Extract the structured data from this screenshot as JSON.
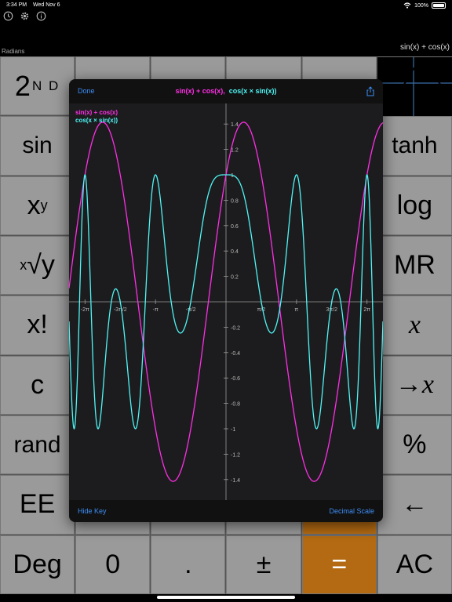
{
  "status_bar": {
    "time": "3:34 PM",
    "date": "Wed Nov 6",
    "battery": "100%"
  },
  "toolbar": {
    "icons": [
      "history-icon",
      "gear-icon",
      "info-icon"
    ],
    "mode": "Radians",
    "expression": "sin(x) + cos(x)"
  },
  "keypad": {
    "rows": [
      [
        "2ND",
        "",
        "",
        "",
        "",
        ""
      ],
      [
        "sin",
        "",
        "",
        "",
        "",
        "tanh"
      ],
      [
        "x^y",
        "",
        "",
        "",
        "",
        "log"
      ],
      [
        "x√y",
        "",
        "",
        "",
        "",
        "MR"
      ],
      [
        "x!",
        "",
        "",
        "",
        "",
        "x"
      ],
      [
        "c",
        "",
        "",
        "",
        "",
        "→x"
      ],
      [
        "rand",
        "",
        "",
        "",
        "",
        "%"
      ],
      [
        "EE",
        "",
        "",
        "",
        "",
        "←"
      ],
      [
        "Deg",
        "0",
        ".",
        "±",
        "=",
        "AC"
      ]
    ]
  },
  "graph": {
    "done_label": "Done",
    "title_fn1": "sin(x) + cos(x),",
    "title_fn2": "cos(x × sin(x))",
    "legend": [
      {
        "name": "sin(x) + cos(x)",
        "color": "#ff2ee6"
      },
      {
        "name": "cos(x × sin(x))",
        "color": "#4ff5f5"
      }
    ],
    "hide_key_label": "Hide Key",
    "scale_label": "Decimal Scale",
    "share_icon": "share-icon"
  },
  "chart_data": {
    "type": "line",
    "title": "sin(x) + cos(x),  cos(x × sin(x))",
    "xlabel": "",
    "ylabel": "",
    "xlim": [
      -7.0,
      7.0
    ],
    "ylim": [
      -1.55,
      1.55
    ],
    "x_ticks": [
      "-2π",
      "-3π/2",
      "-π",
      "-π/2",
      "π/2",
      "π",
      "3π/2",
      "2π"
    ],
    "y_ticks": [
      "1.4",
      "1.2",
      "1",
      "0.8",
      "0.6",
      "0.4",
      "0.2",
      "-0.2",
      "-0.4",
      "-0.6",
      "-0.8",
      "-1",
      "-1.2",
      "-1.4"
    ],
    "series": [
      {
        "name": "sin(x) + cos(x)",
        "color": "#ff2ee6",
        "function": "sin(x)+cos(x)"
      },
      {
        "name": "cos(x × sin(x))",
        "color": "#4ff5f5",
        "function": "cos(x*sin(x))"
      }
    ],
    "grid": false
  }
}
